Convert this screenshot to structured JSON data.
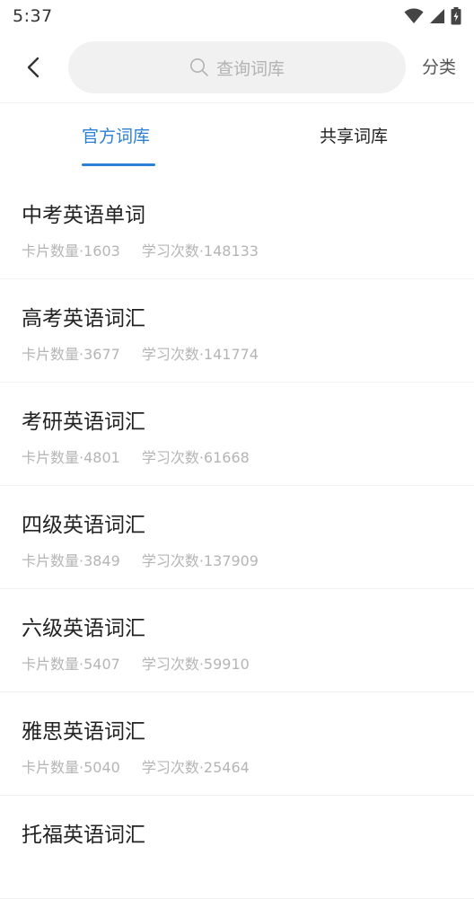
{
  "status_bar": {
    "time": "5:37",
    "icons": [
      "wifi-icon",
      "signal-icon",
      "battery-icon"
    ]
  },
  "header": {
    "back_icon": "chevron-left-icon",
    "search": {
      "icon": "search-icon",
      "placeholder": "查询词库"
    },
    "category_label": "分类"
  },
  "tabs": [
    {
      "label": "官方词库",
      "active": true
    },
    {
      "label": "共享词库",
      "active": false
    }
  ],
  "colors": {
    "accent": "#2a7fd6",
    "muted": "#b5b5b5"
  },
  "wordbanks": [
    {
      "title": "中考英语单词",
      "cards": "卡片数量·1603",
      "studies": "学习次数·148133"
    },
    {
      "title": "高考英语词汇",
      "cards": "卡片数量·3677",
      "studies": "学习次数·141774"
    },
    {
      "title": "考研英语词汇",
      "cards": "卡片数量·4801",
      "studies": "学习次数·61668"
    },
    {
      "title": "四级英语词汇",
      "cards": "卡片数量·3849",
      "studies": "学习次数·137909"
    },
    {
      "title": "六级英语词汇",
      "cards": "卡片数量·5407",
      "studies": "学习次数·59910"
    },
    {
      "title": "雅思英语词汇",
      "cards": "卡片数量·5040",
      "studies": "学习次数·25464"
    },
    {
      "title": "托福英语词汇",
      "cards": "",
      "studies": ""
    }
  ]
}
